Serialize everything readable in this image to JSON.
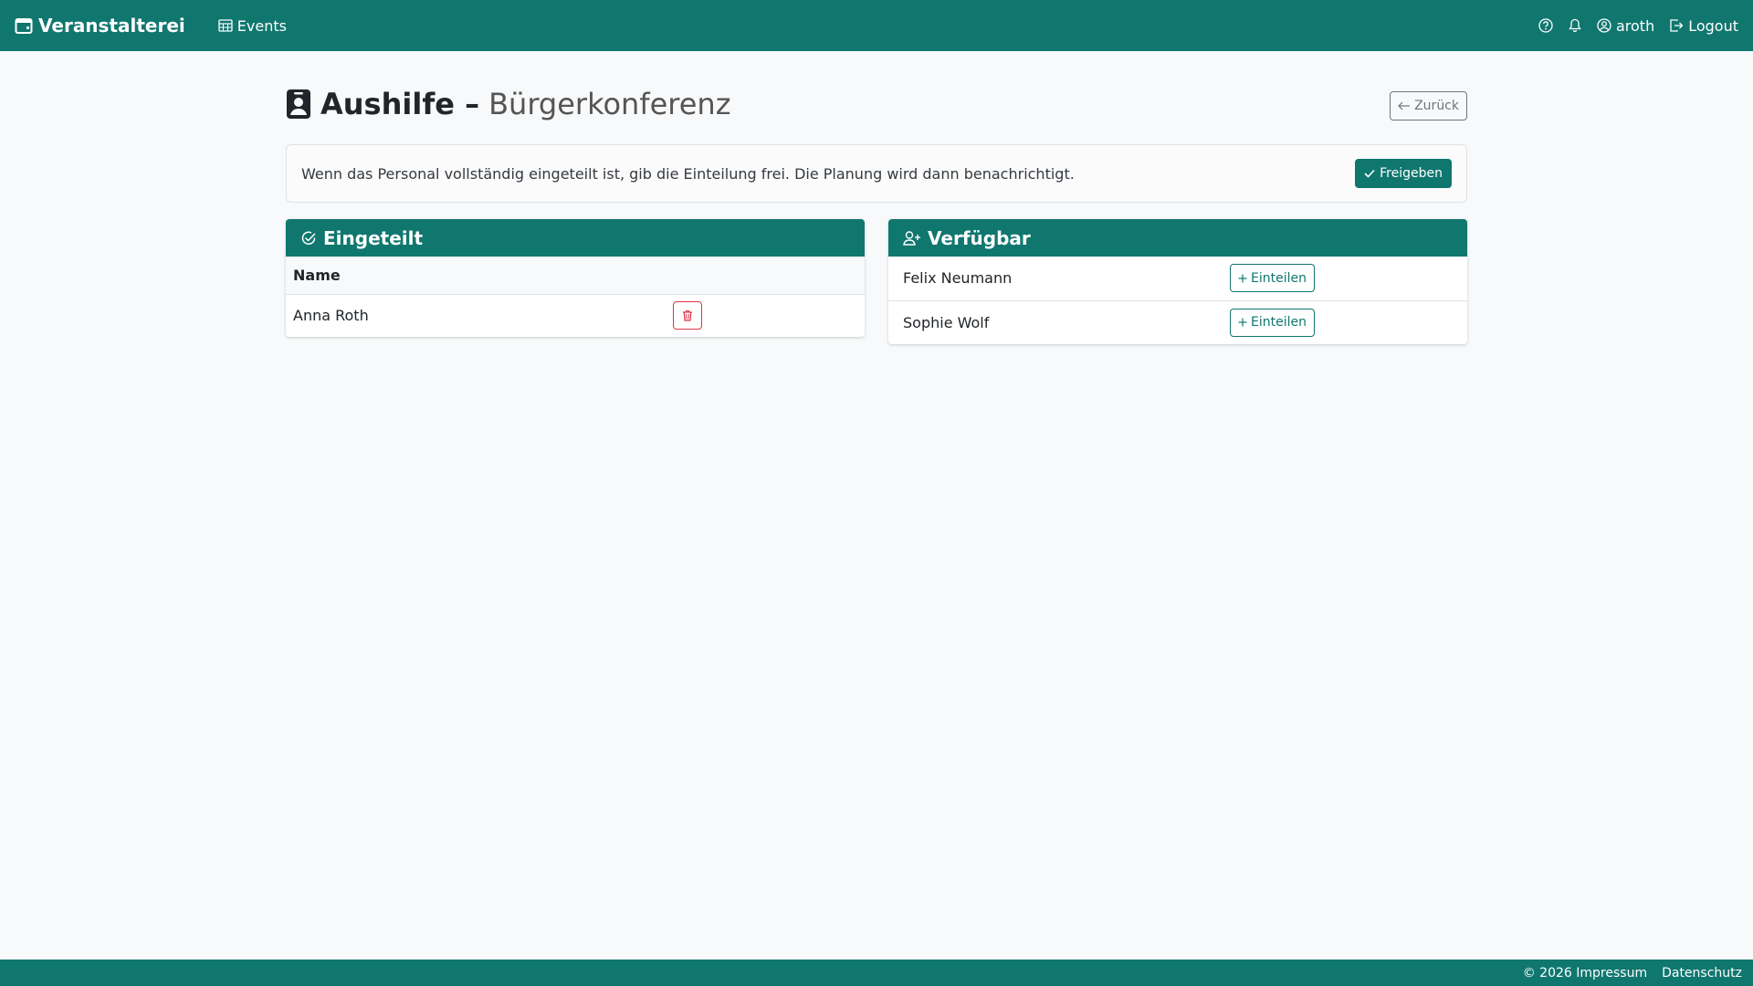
{
  "navbar": {
    "brand": "Veranstalterei",
    "events_link": "Events",
    "user": "aroth",
    "logout": "Logout"
  },
  "page": {
    "title_main": "Aushilfe –",
    "title_sub": "Bürgerkonferenz",
    "back_label": "Zurück"
  },
  "alert": {
    "text": "Wenn das Personal vollständig eingeteilt ist, gib die Einteilung frei. Die Planung wird dann benachrichtigt.",
    "release_label": "Freigeben"
  },
  "assigned": {
    "header": "Eingeteilt",
    "column_name": "Name",
    "rows": [
      {
        "name": "Anna Roth"
      }
    ]
  },
  "available": {
    "header": "Verfügbar",
    "assign_label": "Einteilen",
    "rows": [
      {
        "name": "Felix Neumann"
      },
      {
        "name": "Sophie Wolf"
      }
    ]
  },
  "footer": {
    "copyright": "© 2026 Impressum",
    "privacy": "Datenschutz"
  },
  "colors": {
    "brand": "#10776f",
    "danger": "#dc3545",
    "background": "#f8f9fa"
  }
}
